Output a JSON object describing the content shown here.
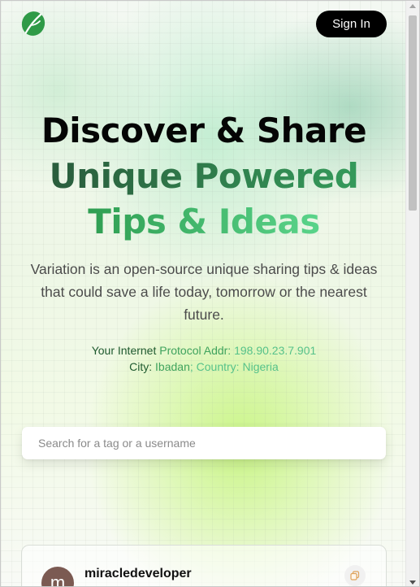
{
  "header": {
    "logo_icon": "leaf-logo-icon",
    "signin_label": "Sign In"
  },
  "hero": {
    "line1": "Discover & Share",
    "line2": "Unique Powered",
    "line3": "Tips & Ideas",
    "description": "Variation is an open-source unique sharing tips & ideas that could save a life today, tomorrow or the nearest future."
  },
  "client_info": {
    "ip_label_part1": "Your Internet ",
    "ip_label_part2": "Protocol Addr: ",
    "ip_value": "198.90.23.7.901",
    "city_label": "City: ",
    "city_value": "Ibadan",
    "country_label": "; Country: ",
    "country_value": "Nigeria"
  },
  "search": {
    "placeholder": "Search for a tag or a username",
    "value": ""
  },
  "feed": {
    "cards": [
      {
        "avatar_letter": "m",
        "username": "miracledeveloper",
        "copy_icon": "copy-icon"
      }
    ]
  },
  "colors": {
    "accent_dark": "#2a5c3c",
    "accent_green": "#3fa35d",
    "accent_light": "#5ad48a",
    "button_bg": "#000000"
  }
}
